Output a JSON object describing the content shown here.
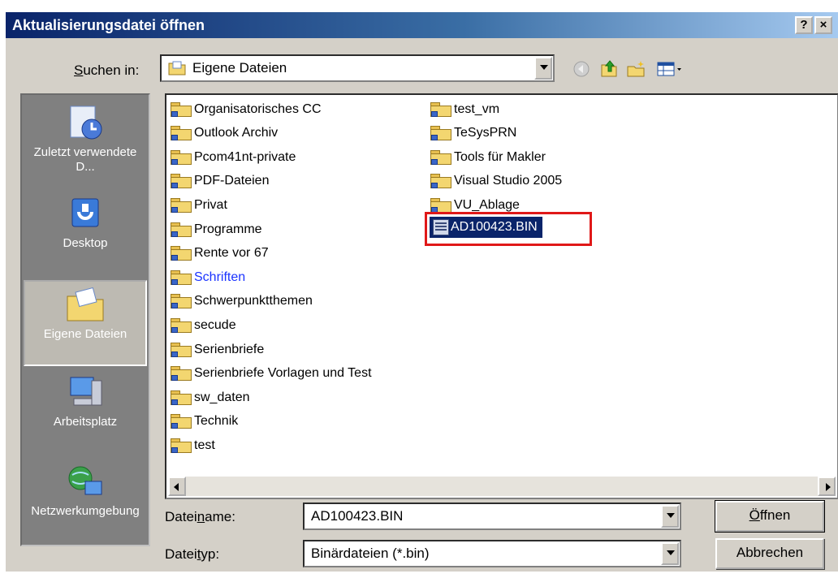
{
  "window": {
    "title": "Aktualisierungsdatei öffnen",
    "help_label": "?",
    "close_label": "×"
  },
  "lookin": {
    "label_pre": "S",
    "label_rest": "uchen in:",
    "value": "Eigene Dateien"
  },
  "places": [
    {
      "label": "Zuletzt verwendete D...",
      "icon": "recent-documents-icon"
    },
    {
      "label": "Desktop",
      "icon": "desktop-icon"
    },
    {
      "label": "Eigene Dateien",
      "icon": "my-documents-icon"
    },
    {
      "label": "Arbeitsplatz",
      "icon": "my-computer-icon"
    },
    {
      "label": "Netzwerkumgebung",
      "icon": "network-icon"
    }
  ],
  "files_col1": [
    "Organisatorisches CC",
    "Outlook Archiv",
    "Pcom41nt-private",
    "PDF-Dateien",
    "Privat",
    "Programme",
    "Rente vor 67",
    "Schriften",
    "Schwerpunktthemen",
    "secude",
    "Serienbriefe",
    "Serienbriefe Vorlagen und Test",
    "sw_daten",
    "Technik",
    "test"
  ],
  "files_col2": [
    "test_vm",
    "TeSysPRN",
    "Tools für Makler",
    "Visual Studio 2005",
    "VU_Ablage"
  ],
  "selected_file": "AD100423.BIN",
  "filename": {
    "label_a": "Datei",
    "label_u": "n",
    "label_b": "ame:",
    "value": "AD100423.BIN"
  },
  "filetype": {
    "label_a": "Datei",
    "label_u": "t",
    "label_b": "yp:",
    "value": "Binärdateien (*.bin)"
  },
  "buttons": {
    "open_u": "Ö",
    "open_rest": "ffnen",
    "cancel": "Abbrechen"
  },
  "colors": {
    "title_start": "#0a246a",
    "selection": "#0a246a",
    "highlight_box": "#e01818"
  }
}
